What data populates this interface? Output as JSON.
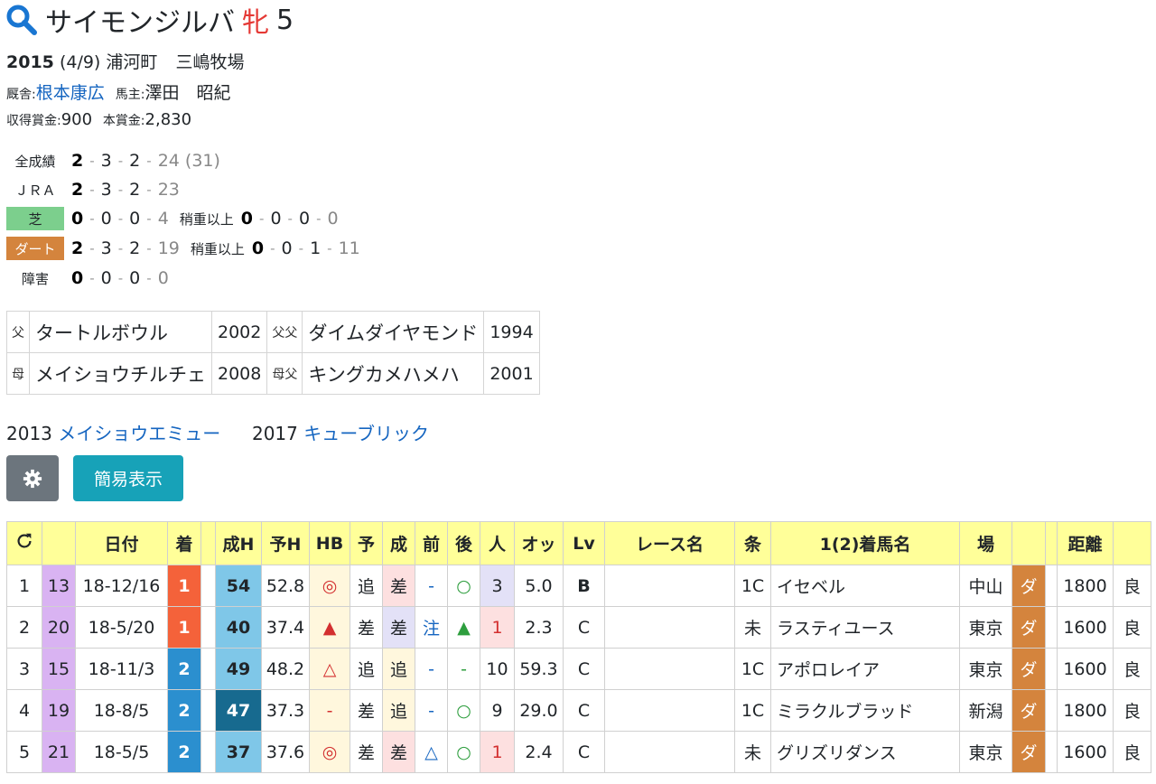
{
  "horse": {
    "name": "サイモンジルバ",
    "sex": "牝",
    "age": "5"
  },
  "birth": {
    "year": "2015",
    "date": "(4/9)",
    "place": "浦河町",
    "farm": "三嶋牧場"
  },
  "stable": {
    "label": "厩舎:",
    "trainer": "根本康広",
    "owner_label": "馬主:",
    "owner": "澤田　昭紀"
  },
  "earnings": {
    "label1": "収得賞金:",
    "value1": "900",
    "label2": "本賞金:",
    "value2": "2,830"
  },
  "records": [
    {
      "label": "全成績",
      "v": [
        "2",
        "3",
        "2",
        "24 (31)"
      ]
    },
    {
      "label": "ＪＲＡ",
      "v": [
        "2",
        "3",
        "2",
        "23"
      ]
    },
    {
      "label": "芝",
      "v": [
        "0",
        "0",
        "0",
        "4"
      ],
      "extra_label": "稍重以上",
      "extra": [
        "0",
        "0",
        "0",
        "0"
      ]
    },
    {
      "label": "ダート",
      "v": [
        "2",
        "3",
        "2",
        "19"
      ],
      "extra_label": "稍重以上",
      "extra": [
        "0",
        "0",
        "1",
        "11"
      ]
    },
    {
      "label": "障害",
      "v": [
        "0",
        "0",
        "0",
        "0"
      ]
    }
  ],
  "pedigree": {
    "sire_label": "父",
    "sire": "タートルボウル",
    "sire_year": "2002",
    "sire_sire_label": "父父",
    "sire_sire": "ダイムダイヤモンド",
    "sire_sire_year": "1994",
    "dam_label": "母",
    "dam": "メイショウチルチェ",
    "dam_year": "2008",
    "dam_sire_label": "母父",
    "dam_sire": "キングカメハメハ",
    "dam_sire_year": "2001"
  },
  "siblings": [
    {
      "year": "2013",
      "name": "メイショウエミュー"
    },
    {
      "year": "2017",
      "name": "キューブリック"
    }
  ],
  "buttons": {
    "settings_icon": "gear-icon",
    "simple_view": "簡易表示"
  },
  "table": {
    "headers": [
      "⟳",
      "",
      "日付",
      "着",
      "",
      "成H",
      "予H",
      "HB",
      "予",
      "成",
      "前",
      "後",
      "人",
      "オッ",
      "Lv",
      "レース名",
      "条",
      "1(2)着馬名",
      "場",
      "",
      "",
      "距離",
      ""
    ],
    "rows": [
      [
        "1",
        "13",
        "18-12/16",
        "1",
        "54",
        "52.8",
        "◎",
        "追",
        "差",
        "-",
        "○",
        "3",
        "5.0",
        "B",
        "",
        "1C",
        "イセベル",
        "中山",
        "ダ",
        "1800",
        "良"
      ],
      [
        "2",
        "20",
        "18-5/20",
        "1",
        "40",
        "37.4",
        "▲",
        "差",
        "差",
        "注",
        "▲",
        "1",
        "2.3",
        "C",
        "",
        "未",
        "ラスティユース",
        "東京",
        "ダ",
        "1600",
        "良"
      ],
      [
        "3",
        "15",
        "18-11/3",
        "2",
        "49",
        "48.2",
        "△",
        "追",
        "追",
        "-",
        "-",
        "10",
        "59.3",
        "C",
        "",
        "1C",
        "アポロレイア",
        "東京",
        "ダ",
        "1600",
        "良"
      ],
      [
        "4",
        "19",
        "18-8/5",
        "2",
        "47",
        "37.3",
        "-",
        "差",
        "追",
        "-",
        "○",
        "9",
        "29.0",
        "C",
        "",
        "1C",
        "ミラクルブラッド",
        "新潟",
        "ダ",
        "1800",
        "良"
      ],
      [
        "5",
        "21",
        "18-5/5",
        "2",
        "37",
        "37.6",
        "◎",
        "差",
        "差",
        "△",
        "○",
        "1",
        "2.4",
        "C",
        "",
        "未",
        "グリズリダンス",
        "東京",
        "ダ",
        "1600",
        "良"
      ]
    ]
  },
  "colors": {
    "win": "#f4623a",
    "second": "#2b8fcf",
    "turf": "#7ccf8d",
    "dirt": "#d4843d",
    "header": "#ffff99"
  }
}
